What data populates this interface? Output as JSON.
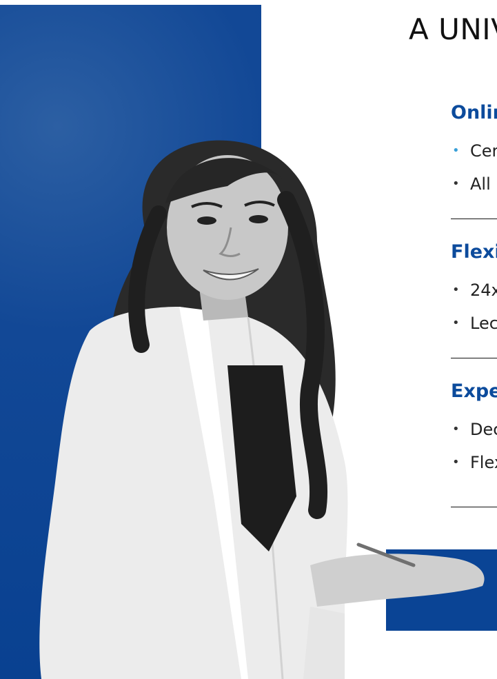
{
  "header": {
    "title": "A UNIV"
  },
  "sections": [
    {
      "title": "Onlin",
      "items": [
        "Cer",
        "All"
      ]
    },
    {
      "title": "Flexi",
      "items": [
        "24x",
        "Lec"
      ]
    },
    {
      "title": "Expe",
      "items": [
        "Dec",
        "Flex"
      ]
    }
  ],
  "colors": {
    "brand_blue": "#0a4495",
    "heading_blue": "#0c4b9c",
    "bullet_accent": "#3aa0d8"
  }
}
